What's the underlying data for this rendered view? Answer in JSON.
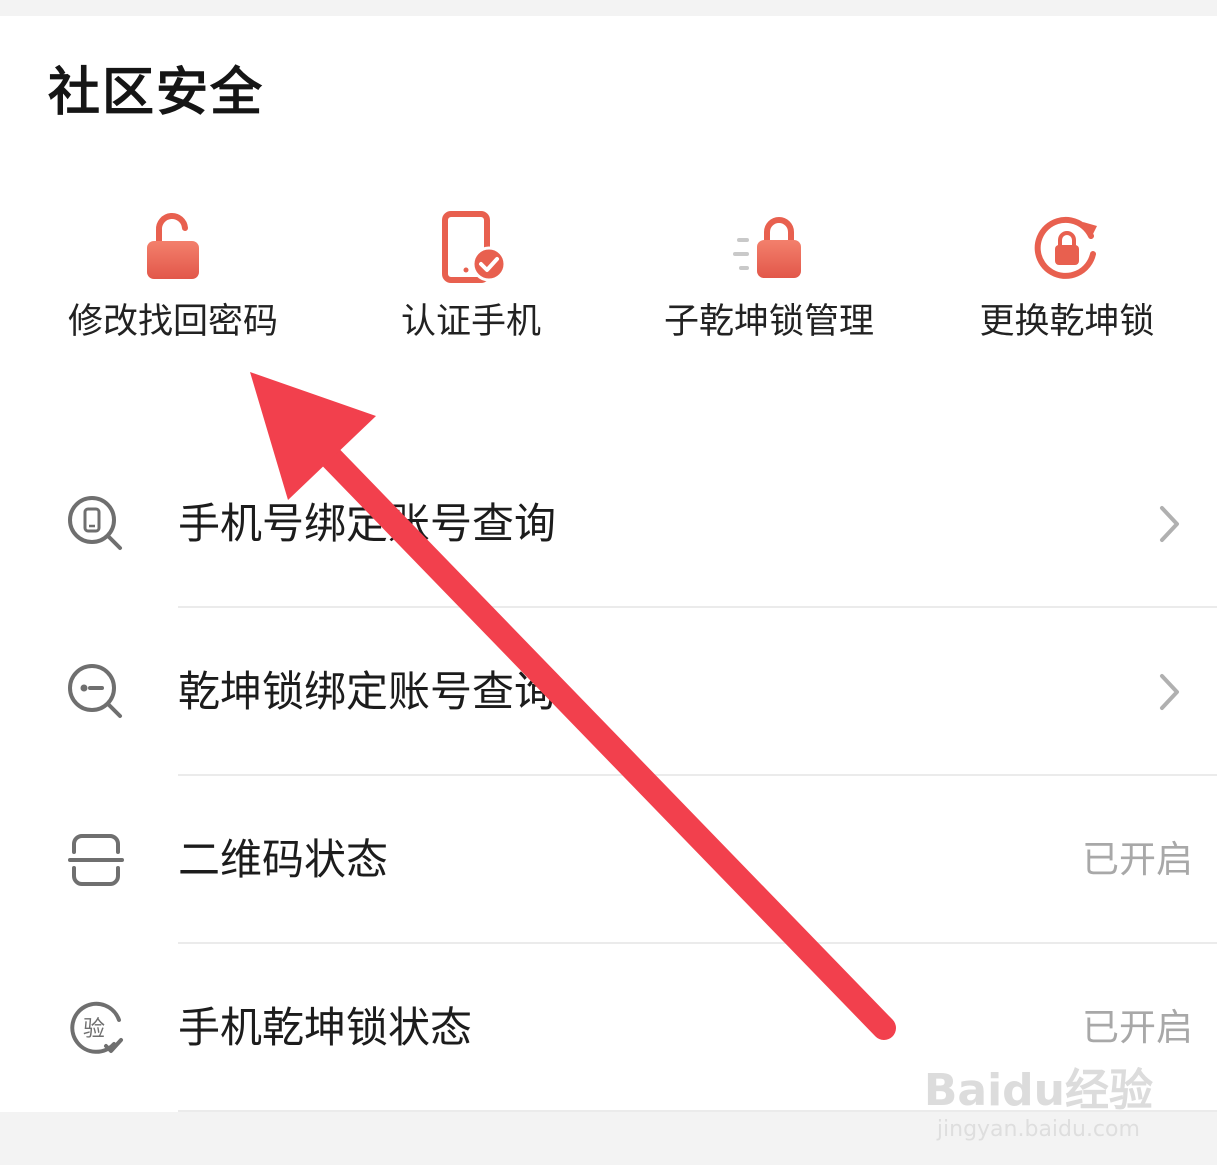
{
  "section": {
    "title": "社区安全"
  },
  "quick_actions": [
    {
      "label": "修改找回密码",
      "icon": "unlock-padlock-icon"
    },
    {
      "label": "认证手机",
      "icon": "phone-verified-icon"
    },
    {
      "label": "子乾坤锁管理",
      "icon": "lock-with-lines-icon"
    },
    {
      "label": "更换乾坤锁",
      "icon": "lock-refresh-icon"
    }
  ],
  "list": [
    {
      "label": "手机号绑定账号查询",
      "icon": "phone-search-icon",
      "trailing": "chevron-right-icon"
    },
    {
      "label": "乾坤锁绑定账号查询",
      "icon": "lock-search-icon",
      "trailing": "chevron-right-icon"
    },
    {
      "label": "二维码状态",
      "icon": "qr-scan-icon",
      "status": "已开启"
    },
    {
      "label": "手机乾坤锁状态",
      "icon": "verify-badge-icon",
      "icon_text": "验",
      "status": "已开启"
    }
  ],
  "watermark": {
    "brand": "Baidu经验",
    "url": "jingyan.baidu.com"
  },
  "colors": {
    "accent": "#e8604f",
    "accent_light": "#f08a76",
    "icon_gray": "#6f6f6f",
    "arrow": "#f2404d",
    "status_text": "#a8a8a8"
  }
}
